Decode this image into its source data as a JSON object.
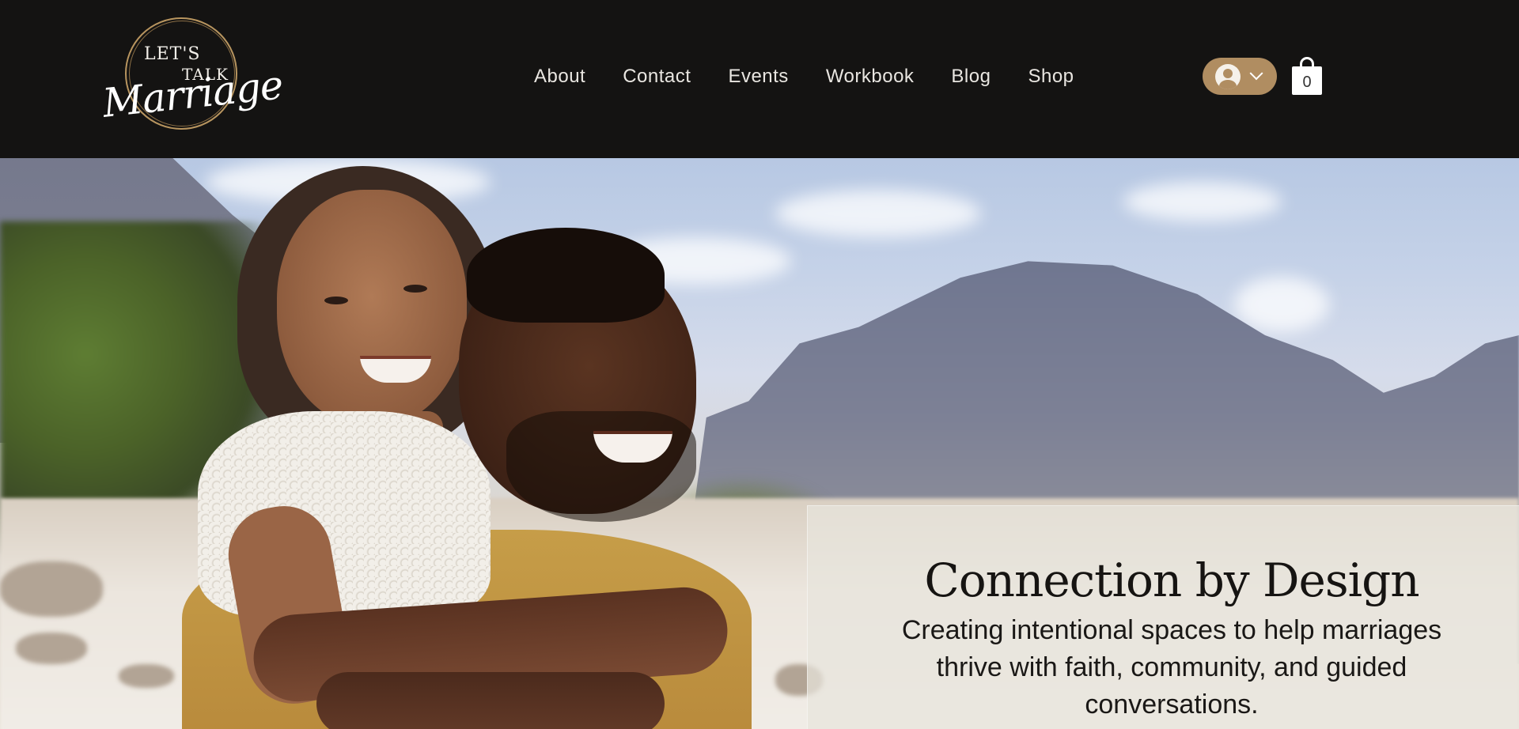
{
  "logo": {
    "line1": "LET'S",
    "line2": "TALK",
    "script": "Marriage"
  },
  "nav": {
    "items": [
      {
        "label": "About"
      },
      {
        "label": "Contact"
      },
      {
        "label": "Events"
      },
      {
        "label": "Workbook"
      },
      {
        "label": "Blog"
      },
      {
        "label": "Shop"
      }
    ]
  },
  "account": {
    "icon": "user-avatar-icon",
    "chevron": "chevron-down-icon"
  },
  "cart": {
    "icon": "shopping-bag-icon",
    "count": "0"
  },
  "hero": {
    "title": "Connection by Design",
    "subtitle": "Creating intentional spaces to help marriages thrive with faith, community, and guided conversations."
  },
  "colors": {
    "header_bg": "#141312",
    "accent": "#b08d61",
    "nav_text": "#e9e6e1",
    "overlay_bg": "#e8e4dc"
  }
}
